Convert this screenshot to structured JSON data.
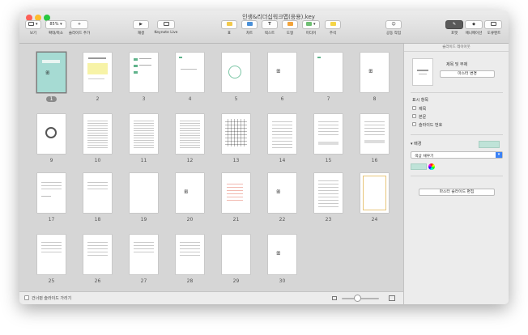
{
  "window": {
    "title": "인생&리더십워크맵(응용).key"
  },
  "toolbar": {
    "zoom_value": "85%",
    "view_label": "보기",
    "zoom_label": "확대/축소",
    "add_slide_label": "슬라이드 추가",
    "play_label": "재생",
    "keynote_live_label": "Keynote Live",
    "table_label": "표",
    "chart_label": "차트",
    "text_label": "텍스트",
    "shape_label": "도형",
    "media_label": "미디어",
    "comment_label": "주석",
    "collaborate_label": "공동 작업",
    "format_label": "포맷",
    "animate_label": "애니메이션",
    "document_label": "도큐멘트"
  },
  "slides": {
    "numbers": [
      "1",
      "2",
      "3",
      "4",
      "5",
      "6",
      "7",
      "8",
      "9",
      "10",
      "11",
      "12",
      "13",
      "14",
      "15",
      "16",
      "17",
      "18",
      "19",
      "20",
      "21",
      "22",
      "23",
      "24",
      "25",
      "26",
      "27",
      "28",
      "29",
      "30"
    ],
    "selected": "1"
  },
  "bottom": {
    "skip_label": "건너뛴 슬라이드 가리기"
  },
  "inspector": {
    "header": "슬라이드 레이아웃",
    "layout_name": "제목 및 부제",
    "change_master_label": "마스터 변경",
    "show_items_title": "표시 항목",
    "item_title": "제목",
    "item_body": "본문",
    "item_slide_number": "슬라이드 번호",
    "background_title": "배경",
    "fill_option": "색상 채우기",
    "edit_master_label": "마스터 슬라이드 편집",
    "background_color": "#bfe3d8"
  }
}
